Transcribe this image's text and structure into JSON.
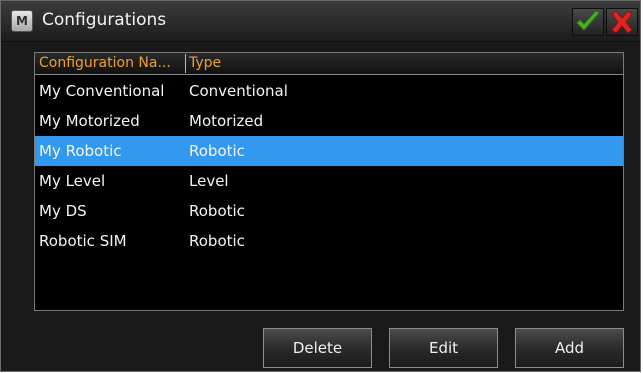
{
  "window": {
    "title": "Configurations",
    "logo_letter": "M",
    "icons": {
      "logo": "app-logo-icon",
      "ok": "checkmark-icon",
      "cancel": "close-x-icon"
    }
  },
  "list": {
    "columns": [
      {
        "label": "Configuration Na..."
      },
      {
        "label": "Type"
      }
    ],
    "rows": [
      {
        "name": "My Conventional",
        "type": "Conventional",
        "selected": false
      },
      {
        "name": "My Motorized",
        "type": "Motorized",
        "selected": false
      },
      {
        "name": "My Robotic",
        "type": "Robotic",
        "selected": true
      },
      {
        "name": "My Level",
        "type": "Level",
        "selected": false
      },
      {
        "name": "My DS",
        "type": "Robotic",
        "selected": false
      },
      {
        "name": "Robotic SIM",
        "type": "Robotic",
        "selected": false
      }
    ]
  },
  "buttons": {
    "delete": "Delete",
    "edit": "Edit",
    "add": "Add"
  },
  "colors": {
    "header_text": "#f0a030",
    "selected_row": "#3399ee",
    "ok_green": "#4caf2a",
    "cancel_red": "#e02424"
  }
}
